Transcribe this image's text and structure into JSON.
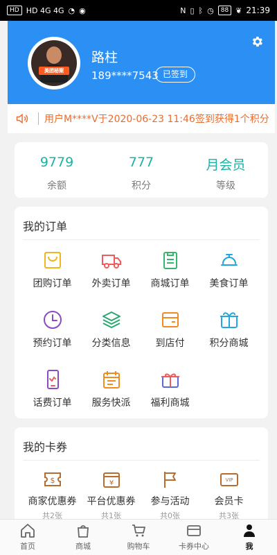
{
  "status": {
    "left_text": "HD 4G 4G",
    "battery": "88",
    "time": "21:39"
  },
  "header": {
    "avatar_badge": "美团秘案",
    "name": "路柱",
    "phone": "189****7543",
    "checkin_label": "已签到",
    "settings_icon": "gear-icon"
  },
  "notice": {
    "text": "用户M****V于2020-06-23 11:46签到获得1个积分"
  },
  "stats": [
    {
      "value": "9779",
      "label": "余额"
    },
    {
      "value": "777",
      "label": "积分"
    },
    {
      "value": "月会员",
      "label": "等级"
    }
  ],
  "orders": {
    "title": "我的订单",
    "items": [
      {
        "label": "团购订单",
        "icon": "shopping-bag-icon",
        "color": "#f3b31c"
      },
      {
        "label": "外卖订单",
        "icon": "delivery-truck-icon",
        "color": "#f05a5a"
      },
      {
        "label": "商城订单",
        "icon": "clipboard-icon",
        "color": "#36b56c"
      },
      {
        "label": "美食订单",
        "icon": "dining-cover-icon",
        "color": "#1ca5df"
      },
      {
        "label": "预约订单",
        "icon": "clock-icon",
        "color": "#8b48c7"
      },
      {
        "label": "分类信息",
        "icon": "layers-icon",
        "color": "#26a86e"
      },
      {
        "label": "到店付",
        "icon": "wallet-icon",
        "color": "#f08b22"
      },
      {
        "label": "积分商城",
        "icon": "gift-box-icon",
        "color": "#22a8df"
      },
      {
        "label": "话费订单",
        "icon": "phone-icon",
        "color": "#8b48c7"
      },
      {
        "label": "服务快派",
        "icon": "calendar-icon",
        "color": "#f08b22"
      },
      {
        "label": "福利商城",
        "icon": "gift-icon",
        "color": "#5b69d8"
      }
    ]
  },
  "coupons": {
    "title": "我的卡券",
    "items": [
      {
        "label": "商家优惠券",
        "count": "共2张",
        "icon": "merchant-coupon-icon"
      },
      {
        "label": "平台优惠券",
        "count": "共1张",
        "icon": "platform-coupon-icon"
      },
      {
        "label": "参与活动",
        "count": "共0张",
        "icon": "flag-icon"
      },
      {
        "label": "会员卡",
        "count": "共3张",
        "icon": "vip-card-icon"
      }
    ]
  },
  "tabs": [
    {
      "label": "首页",
      "icon": "home-icon"
    },
    {
      "label": "商城",
      "icon": "store-bag-icon"
    },
    {
      "label": "购物车",
      "icon": "cart-icon"
    },
    {
      "label": "卡券中心",
      "icon": "card-icon"
    },
    {
      "label": "我",
      "icon": "user-icon",
      "active": true
    }
  ],
  "colors": {
    "primary_blue": "#2c8ff3",
    "teal": "#1bb3a3",
    "orange": "#ec6b2d",
    "coupon_brown": "#b86b2d"
  }
}
